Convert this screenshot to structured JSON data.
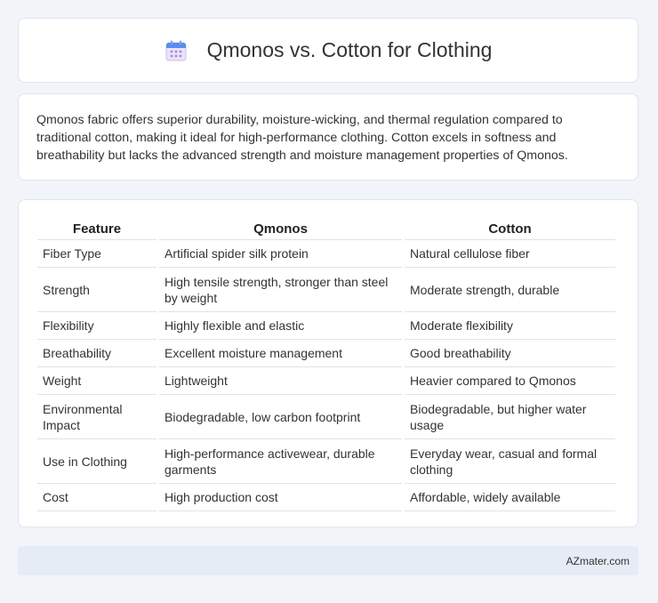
{
  "header": {
    "icon": "calendar-icon",
    "title": "Qmonos vs. Cotton for Clothing"
  },
  "summary": {
    "text": "Qmonos fabric offers superior durability, moisture-wicking, and thermal regulation compared to traditional cotton, making it ideal for high-performance clothing. Cotton excels in softness and breathability but lacks the advanced strength and moisture management properties of Qmonos."
  },
  "table": {
    "headers": [
      "Feature",
      "Qmonos",
      "Cotton"
    ],
    "rows": [
      [
        "Fiber Type",
        "Artificial spider silk protein",
        "Natural cellulose fiber"
      ],
      [
        "Strength",
        "High tensile strength, stronger than steel by weight",
        "Moderate strength, durable"
      ],
      [
        "Flexibility",
        "Highly flexible and elastic",
        "Moderate flexibility"
      ],
      [
        "Breathability",
        "Excellent moisture management",
        "Good breathability"
      ],
      [
        "Weight",
        "Lightweight",
        "Heavier compared to Qmonos"
      ],
      [
        "Environmental Impact",
        "Biodegradable, low carbon footprint",
        "Biodegradable, but higher water usage"
      ],
      [
        "Use in Clothing",
        "High-performance activewear, durable garments",
        "Everyday wear, casual and formal clothing"
      ],
      [
        "Cost",
        "High production cost",
        "Affordable, widely available"
      ]
    ]
  },
  "footer": {
    "brand": "AZmater.com"
  }
}
